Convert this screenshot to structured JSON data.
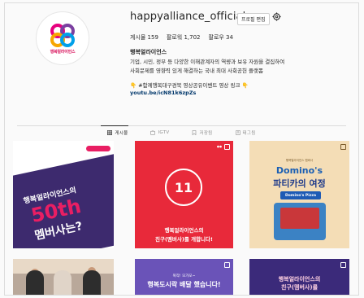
{
  "profile": {
    "avatar_text": "행복얼라이언스",
    "username": "happyalliance_official",
    "edit_label": "프로필 편집",
    "stats": {
      "posts": "게시물 159",
      "followers": "팔로워 1,702",
      "following": "팔로우 34"
    },
    "bio_name": "행복얼라이언스",
    "bio_line1": "기업, 시민, 정부 등 다양한 이해관계자의 역량과 보유 자원을 결집하여",
    "bio_line2": "사회문제를 영향력 있게 해결하는 국내 최대 사회공헌 플랫폼",
    "bio_line3": "👇 #함께행복대구경북 영상공유이벤트 영상 링크 👇",
    "bio_link": "youtu.be/icN81k6zpZs"
  },
  "tabs": [
    {
      "label": "게시물",
      "icon": "grid-icon",
      "active": true
    },
    {
      "label": "IGTV",
      "icon": "tv-icon",
      "active": false
    },
    {
      "label": "저장됨",
      "icon": "bookmark-icon",
      "active": false
    },
    {
      "label": "태그됨",
      "icon": "tag-icon",
      "active": false
    }
  ],
  "posts": {
    "p1": {
      "line1": "행복얼라이언스의",
      "line2": "50th",
      "line3": "멤버사는?"
    },
    "p2": {
      "badge": "11",
      "line1": "행복얼라이언스의",
      "line2": "친구(멤버사)를 개합니다!"
    },
    "p3": {
      "small": "행복얼라이언스 멤버사",
      "line1": "Domino's",
      "line2": "파티카의 여정",
      "sign": "Domino's Pizza"
    },
    "p5": {
      "line1": "복작! 모가모~",
      "line2": "행복도시락 배달 했습니다!"
    },
    "p6": {
      "line1": "행복얼라이언스의",
      "line2": "친구(멤버사)를"
    }
  },
  "colors": {
    "brand": "#d8125b",
    "link": "#00376b",
    "p1_banner": "#3d2a6e",
    "p2_bg": "#e8293a",
    "p3_bg": "#f4ddb6",
    "p5_bg": "#6a53b8",
    "p6_bg": "#3b2a7a"
  }
}
